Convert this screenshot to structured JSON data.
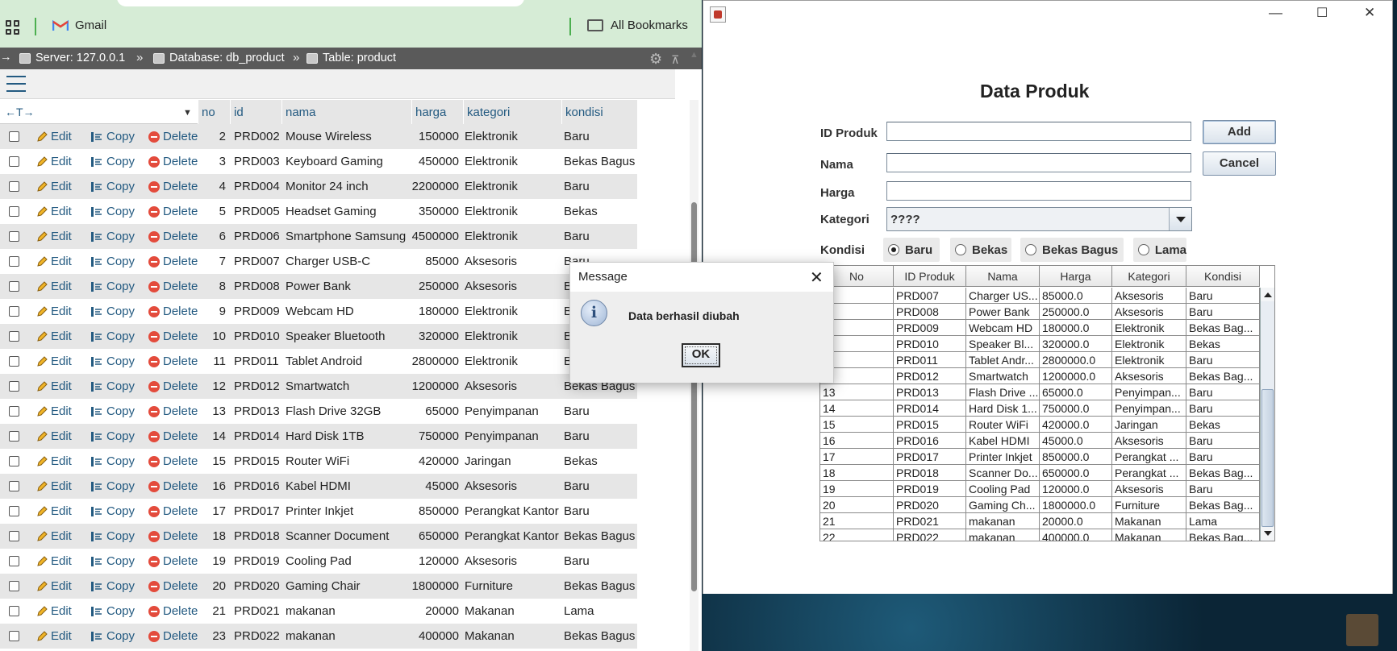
{
  "browser": {
    "bookmarks": {
      "gmail": "Gmail",
      "all_bookmarks": "All Bookmarks"
    },
    "breadcrumb": {
      "server": "Server: 127.0.0.1",
      "database": "Database: db_product",
      "table": "Table: product",
      "separator": "»"
    },
    "columns": {
      "no": "no",
      "id": "id",
      "nama": "nama",
      "harga": "harga",
      "kategori": "kategori",
      "kondisi": "kondisi"
    },
    "actions": {
      "edit": "Edit",
      "copy": "Copy",
      "delete": "Delete"
    },
    "rows": [
      {
        "no": "2",
        "id": "PRD002",
        "nama": "Mouse Wireless",
        "harga": "150000",
        "kategori": "Elektronik",
        "kondisi": "Baru"
      },
      {
        "no": "3",
        "id": "PRD003",
        "nama": "Keyboard Gaming",
        "harga": "450000",
        "kategori": "Elektronik",
        "kondisi": "Bekas Bagus"
      },
      {
        "no": "4",
        "id": "PRD004",
        "nama": "Monitor 24 inch",
        "harga": "2200000",
        "kategori": "Elektronik",
        "kondisi": "Baru"
      },
      {
        "no": "5",
        "id": "PRD005",
        "nama": "Headset Gaming",
        "harga": "350000",
        "kategori": "Elektronik",
        "kondisi": "Bekas"
      },
      {
        "no": "6",
        "id": "PRD006",
        "nama": "Smartphone Samsung",
        "harga": "4500000",
        "kategori": "Elektronik",
        "kondisi": "Baru"
      },
      {
        "no": "7",
        "id": "PRD007",
        "nama": "Charger USB-C",
        "harga": "85000",
        "kategori": "Aksesoris",
        "kondisi": "Baru"
      },
      {
        "no": "8",
        "id": "PRD008",
        "nama": "Power Bank",
        "harga": "250000",
        "kategori": "Aksesoris",
        "kondisi": "B"
      },
      {
        "no": "9",
        "id": "PRD009",
        "nama": "Webcam HD",
        "harga": "180000",
        "kategori": "Elektronik",
        "kondisi": "B"
      },
      {
        "no": "10",
        "id": "PRD010",
        "nama": "Speaker Bluetooth",
        "harga": "320000",
        "kategori": "Elektronik",
        "kondisi": "B"
      },
      {
        "no": "11",
        "id": "PRD011",
        "nama": "Tablet Android",
        "harga": "2800000",
        "kategori": "Elektronik",
        "kondisi": "B"
      },
      {
        "no": "12",
        "id": "PRD012",
        "nama": "Smartwatch",
        "harga": "1200000",
        "kategori": "Aksesoris",
        "kondisi": "Bekas Bagus"
      },
      {
        "no": "13",
        "id": "PRD013",
        "nama": "Flash Drive 32GB",
        "harga": "65000",
        "kategori": "Penyimpanan",
        "kondisi": "Baru"
      },
      {
        "no": "14",
        "id": "PRD014",
        "nama": "Hard Disk 1TB",
        "harga": "750000",
        "kategori": "Penyimpanan",
        "kondisi": "Baru"
      },
      {
        "no": "15",
        "id": "PRD015",
        "nama": "Router WiFi",
        "harga": "420000",
        "kategori": "Jaringan",
        "kondisi": "Bekas"
      },
      {
        "no": "16",
        "id": "PRD016",
        "nama": "Kabel HDMI",
        "harga": "45000",
        "kategori": "Aksesoris",
        "kondisi": "Baru"
      },
      {
        "no": "17",
        "id": "PRD017",
        "nama": "Printer Inkjet",
        "harga": "850000",
        "kategori": "Perangkat Kantor",
        "kondisi": "Baru"
      },
      {
        "no": "18",
        "id": "PRD018",
        "nama": "Scanner Document",
        "harga": "650000",
        "kategori": "Perangkat Kantor",
        "kondisi": "Bekas Bagus"
      },
      {
        "no": "19",
        "id": "PRD019",
        "nama": "Cooling Pad",
        "harga": "120000",
        "kategori": "Aksesoris",
        "kondisi": "Baru"
      },
      {
        "no": "20",
        "id": "PRD020",
        "nama": "Gaming Chair",
        "harga": "1800000",
        "kategori": "Furniture",
        "kondisi": "Bekas Bagus"
      },
      {
        "no": "21",
        "id": "PRD021",
        "nama": "makanan",
        "harga": "20000",
        "kategori": "Makanan",
        "kondisi": "Lama"
      },
      {
        "no": "23",
        "id": "PRD022",
        "nama": "makanan",
        "harga": "400000",
        "kategori": "Makanan",
        "kondisi": "Bekas Bagus"
      }
    ]
  },
  "app": {
    "title": "Data Produk",
    "labels": {
      "id": "ID Produk",
      "nama": "Nama",
      "harga": "Harga",
      "kategori": "Kategori",
      "kondisi": "Kondisi"
    },
    "fields": {
      "id": "",
      "nama": "",
      "harga": ""
    },
    "kategori_value": "????",
    "buttons": {
      "add": "Add",
      "cancel": "Cancel"
    },
    "radios": [
      {
        "label": "Baru",
        "selected": true
      },
      {
        "label": "Bekas",
        "selected": false
      },
      {
        "label": "Bekas Bagus",
        "selected": false
      },
      {
        "label": "Lama",
        "selected": false
      }
    ],
    "table": {
      "headers": [
        "No",
        "ID Produk",
        "Nama",
        "Harga",
        "Kategori",
        "Kondisi"
      ],
      "rows": [
        [
          "",
          "PRD007",
          "Charger US...",
          "85000.0",
          "Aksesoris",
          "Baru"
        ],
        [
          "",
          "PRD008",
          "Power Bank",
          "250000.0",
          "Aksesoris",
          "Baru"
        ],
        [
          "",
          "PRD009",
          "Webcam HD",
          "180000.0",
          "Elektronik",
          "Bekas Bag..."
        ],
        [
          "",
          "PRD010",
          "Speaker Bl...",
          "320000.0",
          "Elektronik",
          "Bekas"
        ],
        [
          "",
          "PRD011",
          "Tablet Andr...",
          "2800000.0",
          "Elektronik",
          "Baru"
        ],
        [
          "",
          "PRD012",
          "Smartwatch",
          "1200000.0",
          "Aksesoris",
          "Bekas Bag..."
        ],
        [
          "13",
          "PRD013",
          "Flash Drive ...",
          "65000.0",
          "Penyimpan...",
          "Baru"
        ],
        [
          "14",
          "PRD014",
          "Hard Disk 1...",
          "750000.0",
          "Penyimpan...",
          "Baru"
        ],
        [
          "15",
          "PRD015",
          "Router WiFi",
          "420000.0",
          "Jaringan",
          "Bekas"
        ],
        [
          "16",
          "PRD016",
          "Kabel HDMI",
          "45000.0",
          "Aksesoris",
          "Baru"
        ],
        [
          "17",
          "PRD017",
          "Printer Inkjet",
          "850000.0",
          "Perangkat ...",
          "Baru"
        ],
        [
          "18",
          "PRD018",
          "Scanner Do...",
          "650000.0",
          "Perangkat ...",
          "Bekas Bag..."
        ],
        [
          "19",
          "PRD019",
          "Cooling Pad",
          "120000.0",
          "Aksesoris",
          "Baru"
        ],
        [
          "20",
          "PRD020",
          "Gaming Ch...",
          "1800000.0",
          "Furniture",
          "Bekas Bag..."
        ],
        [
          "21",
          "PRD021",
          "makanan",
          "20000.0",
          "Makanan",
          "Lama"
        ],
        [
          "22",
          "PRD022",
          "makanan",
          "400000.0",
          "Makanan",
          "Bekas Bag..."
        ]
      ]
    }
  },
  "dialog": {
    "title": "Message",
    "message": "Data berhasil diubah",
    "ok": "OK",
    "icon": "info-icon"
  },
  "colors": {
    "pma_link": "#235a81",
    "pma_nav": "#5a5a5a",
    "bookmarks_bar": "#d6ecd6",
    "delete_red": "#e34b3c"
  }
}
